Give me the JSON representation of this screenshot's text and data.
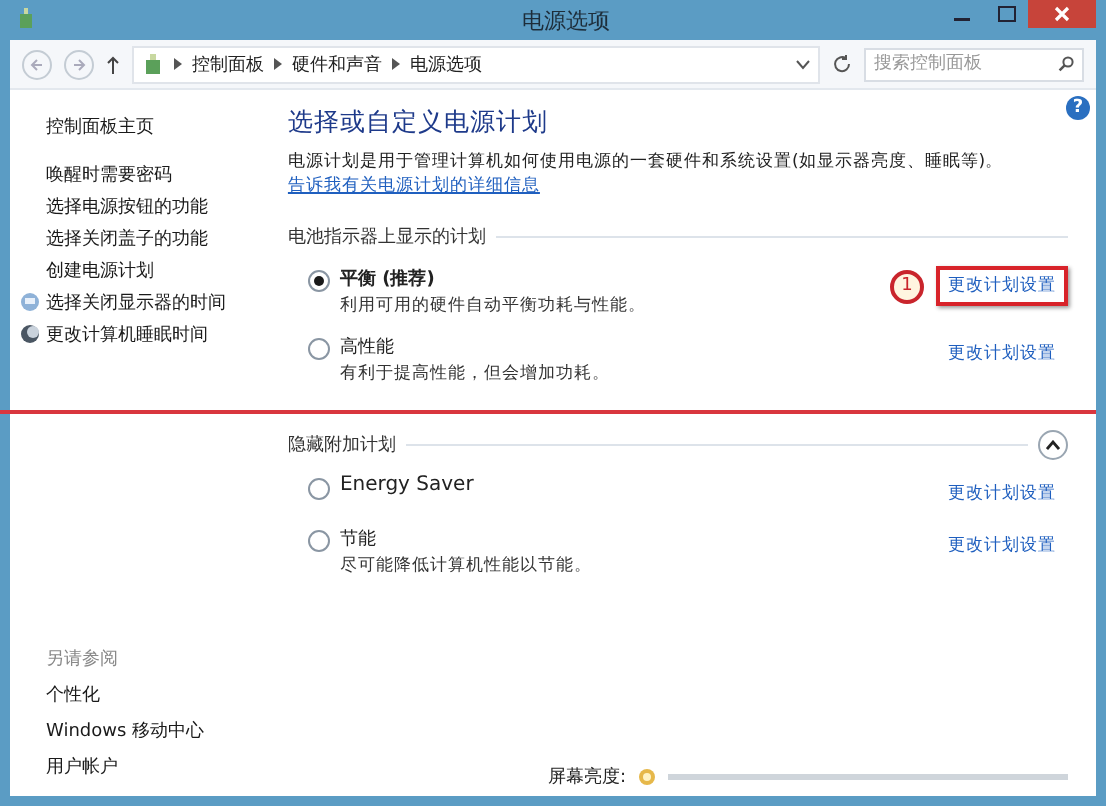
{
  "window": {
    "title": "电源选项"
  },
  "help_button": "?",
  "address_bar": {
    "breadcrumbs": [
      "控制面板",
      "硬件和声音",
      "电源选项"
    ],
    "search": {
      "placeholder": "搜索控制面板"
    }
  },
  "sidebar": {
    "home": "控制面板主页",
    "links": [
      {
        "label": "唤醒时需要密码",
        "kind": "plain"
      },
      {
        "label": "选择电源按钮的功能",
        "kind": "plain"
      },
      {
        "label": "选择关闭盖子的功能",
        "kind": "plain"
      },
      {
        "label": "创建电源计划",
        "kind": "plain"
      },
      {
        "label": "选择关闭显示器的时间",
        "kind": "display"
      },
      {
        "label": "更改计算机睡眠时间",
        "kind": "sleep"
      }
    ],
    "see_also": {
      "title": "另请参阅",
      "links": [
        "个性化",
        "Windows 移动中心",
        "用户帐户"
      ]
    }
  },
  "main": {
    "heading": "选择或自定义电源计划",
    "description": "电源计划是用于管理计算机如何使用电源的一套硬件和系统设置(如显示器亮度、睡眠等)。",
    "description_link": "告诉我有关电源计划的详细信息",
    "groups": [
      {
        "title": "电池指示器上显示的计划",
        "collapse_button": false,
        "plans": [
          {
            "name": "平衡 (推荐)",
            "selected": true,
            "description": "利用可用的硬件自动平衡功耗与性能。",
            "link": "更改计划设置",
            "highlighted": true,
            "marker": "1"
          },
          {
            "name": "高性能",
            "selected": false,
            "description": "有利于提高性能，但会增加功耗。",
            "link": "更改计划设置",
            "highlighted": false
          }
        ]
      },
      {
        "title": "隐藏附加计划",
        "collapse_button": true,
        "plans": [
          {
            "name": "Energy Saver",
            "selected": false,
            "link": "更改计划设置",
            "highlighted": false
          },
          {
            "name": "节能",
            "selected": false,
            "description": "尽可能降低计算机性能以节能。",
            "link": "更改计划设置",
            "highlighted": false
          }
        ]
      }
    ],
    "brightness": {
      "label": "屏幕亮度:"
    }
  }
}
